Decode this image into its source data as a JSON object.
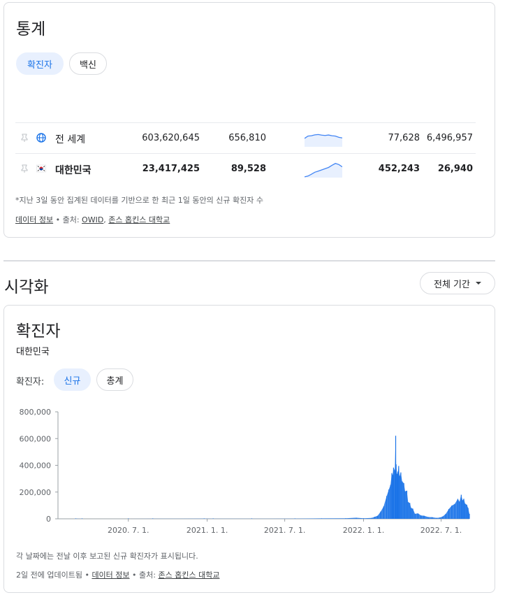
{
  "stats": {
    "title": "통계",
    "tabs": [
      {
        "label": "확진자",
        "active": true
      },
      {
        "label": "백신",
        "active": false
      }
    ],
    "rows": [
      {
        "name": "전 세계",
        "icon": "globe-icon",
        "total_cases": "603,620,645",
        "new_cases": "656,810",
        "trend": [
          0.55,
          0.7,
          0.72,
          0.78,
          0.8,
          0.76,
          0.74,
          0.77,
          0.72,
          0.7,
          0.62,
          0.58
        ],
        "col4": "77,628",
        "col5": "6,496,957",
        "bold": false
      },
      {
        "name": "대한민국",
        "icon": "korea-flag-icon",
        "total_cases": "23,417,425",
        "new_cases": "89,528",
        "trend": [
          0.05,
          0.1,
          0.22,
          0.35,
          0.42,
          0.5,
          0.58,
          0.66,
          0.8,
          0.92,
          0.85,
          0.7
        ],
        "col4": "452,243",
        "col5": "26,940",
        "bold": true
      }
    ],
    "footnote": "*지난 3일 동안 집계된 데이터를 기반으로 한 최근 1일 동안의 신규 확진자 수",
    "data_info": "데이터 정보",
    "source_prefix": " • 출처: ",
    "source_owid": "OWID",
    "source_sep": ", ",
    "source_jhu": "존스 홉킨스 대학교"
  },
  "viz": {
    "title": "시각화",
    "period_button": "전체 기간"
  },
  "chart_card": {
    "title": "확진자",
    "subtitle": "대한민국",
    "toggle_label": "확진자:",
    "toggles": [
      {
        "label": "신규",
        "active": true
      },
      {
        "label": "총계",
        "active": false
      }
    ],
    "caption": "각 날짜에는 전날 이후 보고된 신규 확진자가 표시됩니다.",
    "updated": "2일 전에 업데이트됨",
    "data_info": "데이터 정보",
    "source_prefix": " • 출처: ",
    "source_jhu": "존스 홉킨스 대학교"
  },
  "chart_data": {
    "type": "bar",
    "title": "",
    "xlabel": "",
    "ylabel": "",
    "ylim": [
      0,
      800000
    ],
    "y_ticks": [
      0,
      200000,
      400000,
      600000,
      800000
    ],
    "y_tick_labels": [
      "0",
      "200,000",
      "400,000",
      "600,000",
      "800,000"
    ],
    "x_tick_labels": [
      "2020. 7. 1.",
      "2021. 1. 1.",
      "2021. 7. 1.",
      "2022. 1. 1.",
      "2022. 7. 1."
    ],
    "x_tick_dates": [
      "2020-07-01",
      "2021-01-01",
      "2021-07-01",
      "2022-01-01",
      "2022-07-01"
    ],
    "x_range": [
      "2020-01-22",
      "2022-09-05"
    ],
    "bar_color": "#1a73e8",
    "series": [
      {
        "points": [
          [
            "2020-02-29",
            900
          ],
          [
            "2020-03-15",
            100
          ],
          [
            "2020-07-01",
            60
          ],
          [
            "2020-08-27",
            400
          ],
          [
            "2020-12-25",
            1200
          ],
          [
            "2021-01-15",
            500
          ],
          [
            "2021-04-15",
            700
          ],
          [
            "2021-07-25",
            1800
          ],
          [
            "2021-09-25",
            3200
          ],
          [
            "2021-11-20",
            4000
          ],
          [
            "2021-12-15",
            7800
          ],
          [
            "2022-01-01",
            4400
          ],
          [
            "2022-01-20",
            6800
          ],
          [
            "2022-01-27",
            14500
          ],
          [
            "2022-02-03",
            22900
          ],
          [
            "2022-02-10",
            54000
          ],
          [
            "2022-02-17",
            93000
          ],
          [
            "2022-02-24",
            170000
          ],
          [
            "2022-03-01",
            219000
          ],
          [
            "2022-03-05",
            254000
          ],
          [
            "2022-03-08",
            342000
          ],
          [
            "2022-03-10",
            327000
          ],
          [
            "2022-03-12",
            383000
          ],
          [
            "2022-03-15",
            362000
          ],
          [
            "2022-03-17",
            621000
          ],
          [
            "2022-03-18",
            407000
          ],
          [
            "2022-03-20",
            334000
          ],
          [
            "2022-03-22",
            353000
          ],
          [
            "2022-03-24",
            395000
          ],
          [
            "2022-03-26",
            319000
          ],
          [
            "2022-03-29",
            347000
          ],
          [
            "2022-04-01",
            280000
          ],
          [
            "2022-04-05",
            266000
          ],
          [
            "2022-04-08",
            205000
          ],
          [
            "2022-04-12",
            210000
          ],
          [
            "2022-04-15",
            125000
          ],
          [
            "2022-04-19",
            118000
          ],
          [
            "2022-04-22",
            81000
          ],
          [
            "2022-04-26",
            76000
          ],
          [
            "2022-05-01",
            37000
          ],
          [
            "2022-05-08",
            40000
          ],
          [
            "2022-05-15",
            25000
          ],
          [
            "2022-05-22",
            23000
          ],
          [
            "2022-06-01",
            13000
          ],
          [
            "2022-06-10",
            12000
          ],
          [
            "2022-06-20",
            7000
          ],
          [
            "2022-06-28",
            9500
          ],
          [
            "2022-07-05",
            18000
          ],
          [
            "2022-07-12",
            37000
          ],
          [
            "2022-07-19",
            73000
          ],
          [
            "2022-07-26",
            99000
          ],
          [
            "2022-08-02",
            111000
          ],
          [
            "2022-08-09",
            149000
          ],
          [
            "2022-08-13",
            128000
          ],
          [
            "2022-08-17",
            180000
          ],
          [
            "2022-08-20",
            138000
          ],
          [
            "2022-08-23",
            150000
          ],
          [
            "2022-08-26",
            113000
          ],
          [
            "2022-08-30",
            105000
          ],
          [
            "2022-09-02",
            81000
          ],
          [
            "2022-09-05",
            37000
          ]
        ]
      }
    ]
  }
}
